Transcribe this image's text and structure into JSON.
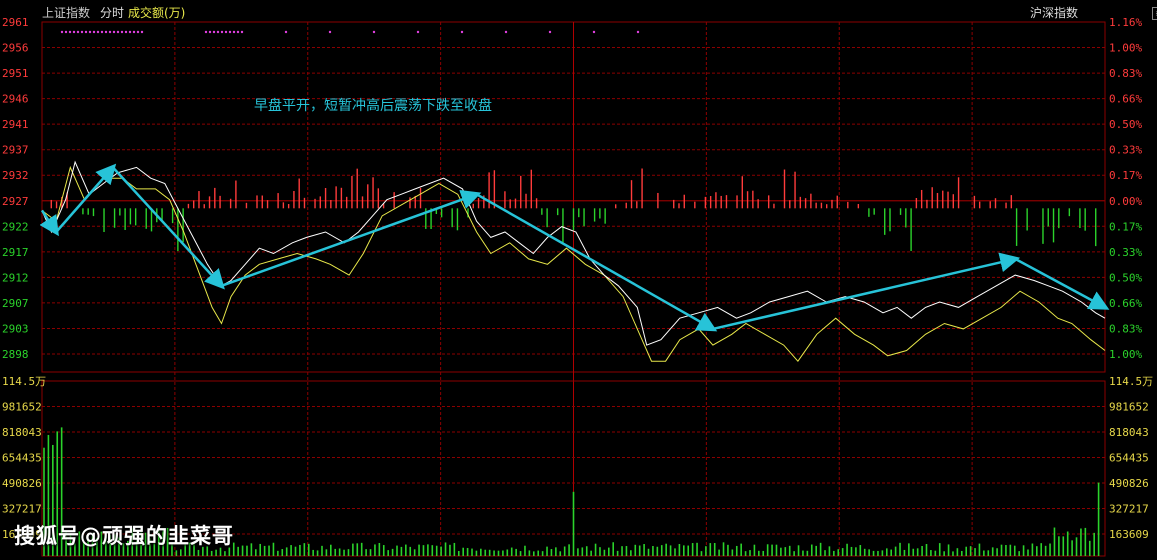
{
  "header": {
    "index_name": "上证指数",
    "period": "分时",
    "indicator": "成交额(万)",
    "right_label": "沪深指数"
  },
  "annotation": "早盘平开，短暂冲高后震荡下跌至收盘",
  "watermark": "搜狐号@顽强的韭菜哥",
  "colors": {
    "price_line": "#ffffff",
    "avg_line": "#e8e84a",
    "up": "#ff3b3b",
    "down": "#2bd32b",
    "grid": "#8b0000",
    "arrow": "#27c3d8",
    "volume": "#2bd32b"
  },
  "chart_data": [
    {
      "type": "line",
      "title": "上证指数 分时",
      "y_left_ticks": [
        "2961",
        "2956",
        "2951",
        "2946",
        "2941",
        "2937",
        "2932",
        "2927",
        "2922",
        "2917",
        "2912",
        "2907",
        "2903",
        "2898"
      ],
      "y_right_ticks": [
        "1.16%",
        "1.00%",
        "0.83%",
        "0.66%",
        "0.50%",
        "0.33%",
        "0.17%",
        "0.00%",
        "0.17%",
        "0.33%",
        "0.50%",
        "0.66%",
        "0.83%",
        "1.00%"
      ],
      "ylim": [
        2896,
        2961
      ],
      "x": "minute index 0-240",
      "series": [
        {
          "name": "price",
          "points": [
            [
              0,
              2926
            ],
            [
              4,
              2922
            ],
            [
              10,
              2928
            ],
            [
              14,
              2935
            ],
            [
              20,
              2929
            ],
            [
              26,
              2931
            ],
            [
              32,
              2933
            ],
            [
              40,
              2934
            ],
            [
              46,
              2932
            ],
            [
              52,
              2931
            ],
            [
              58,
              2926
            ],
            [
              64,
              2921
            ],
            [
              70,
              2916
            ],
            [
              76,
              2912
            ],
            [
              80,
              2913
            ],
            [
              86,
              2916
            ],
            [
              92,
              2919
            ],
            [
              98,
              2918
            ],
            [
              106,
              2920
            ],
            [
              112,
              2921
            ],
            [
              120,
              2922
            ],
            [
              128,
              2920
            ],
            [
              134,
              2922
            ],
            [
              140,
              2925
            ],
            [
              146,
              2928
            ],
            [
              152,
              2929
            ],
            [
              158,
              2930
            ],
            [
              164,
              2931
            ],
            [
              170,
              2932
            ],
            [
              178,
              2930
            ],
            [
              184,
              2924
            ],
            [
              190,
              2921
            ],
            [
              196,
              2922
            ],
            [
              202,
              2920
            ],
            [
              208,
              2918
            ],
            [
              214,
              2921
            ],
            [
              220,
              2923
            ],
            [
              226,
              2922
            ],
            [
              232,
              2917
            ],
            [
              238,
              2914
            ],
            [
              244,
              2912
            ],
            [
              252,
              2908
            ],
            [
              256,
              2901
            ],
            [
              262,
              2902
            ],
            [
              270,
              2906
            ],
            [
              278,
              2907
            ],
            [
              286,
              2908
            ],
            [
              294,
              2906
            ],
            [
              300,
              2907
            ],
            [
              308,
              2909
            ],
            [
              316,
              2910
            ],
            [
              324,
              2911
            ],
            [
              332,
              2909
            ],
            [
              340,
              2910
            ],
            [
              348,
              2909
            ],
            [
              356,
              2907
            ],
            [
              362,
              2908
            ],
            [
              368,
              2906
            ],
            [
              374,
              2908
            ],
            [
              380,
              2909
            ],
            [
              388,
              2908
            ],
            [
              396,
              2910
            ],
            [
              404,
              2912
            ],
            [
              412,
              2914
            ],
            [
              420,
              2913
            ],
            [
              426,
              2912
            ],
            [
              432,
              2911
            ],
            [
              440,
              2909
            ],
            [
              446,
              2907
            ],
            [
              450,
              2906
            ]
          ]
        },
        {
          "name": "average",
          "points": [
            [
              0,
              2926
            ],
            [
              6,
              2924
            ],
            [
              12,
              2934
            ],
            [
              18,
              2928
            ],
            [
              26,
              2932
            ],
            [
              34,
              2932
            ],
            [
              40,
              2930
            ],
            [
              48,
              2930
            ],
            [
              54,
              2928
            ],
            [
              60,
              2922
            ],
            [
              66,
              2915
            ],
            [
              72,
              2908
            ],
            [
              76,
              2905
            ],
            [
              80,
              2910
            ],
            [
              86,
              2914
            ],
            [
              92,
              2916
            ],
            [
              100,
              2917
            ],
            [
              108,
              2918
            ],
            [
              116,
              2917
            ],
            [
              122,
              2916
            ],
            [
              130,
              2914
            ],
            [
              136,
              2918
            ],
            [
              144,
              2925
            ],
            [
              152,
              2927
            ],
            [
              160,
              2929
            ],
            [
              168,
              2931
            ],
            [
              176,
              2929
            ],
            [
              184,
              2922
            ],
            [
              190,
              2918
            ],
            [
              198,
              2920
            ],
            [
              206,
              2917
            ],
            [
              214,
              2916
            ],
            [
              222,
              2919
            ],
            [
              230,
              2916
            ],
            [
              238,
              2914
            ],
            [
              246,
              2910
            ],
            [
              252,
              2904
            ],
            [
              258,
              2898
            ],
            [
              264,
              2898
            ],
            [
              270,
              2902
            ],
            [
              278,
              2904
            ],
            [
              284,
              2901
            ],
            [
              292,
              2903
            ],
            [
              298,
              2905
            ],
            [
              306,
              2903
            ],
            [
              314,
              2901
            ],
            [
              320,
              2898
            ],
            [
              328,
              2903
            ],
            [
              336,
              2906
            ],
            [
              344,
              2903
            ],
            [
              352,
              2901
            ],
            [
              358,
              2899
            ],
            [
              366,
              2900
            ],
            [
              374,
              2903
            ],
            [
              382,
              2905
            ],
            [
              390,
              2904
            ],
            [
              398,
              2906
            ],
            [
              406,
              2908
            ],
            [
              414,
              2911
            ],
            [
              422,
              2909
            ],
            [
              430,
              2906
            ],
            [
              436,
              2905
            ],
            [
              444,
              2902
            ],
            [
              450,
              2900
            ]
          ]
        }
      ],
      "trend_arrows": [
        {
          "from": [
            0,
            2926
          ],
          "to": [
            6,
            2922
          ]
        },
        {
          "from": [
            6,
            2922
          ],
          "to": [
            30,
            2934
          ]
        },
        {
          "from": [
            30,
            2934
          ],
          "to": [
            76,
            2912
          ]
        },
        {
          "from": [
            76,
            2912
          ],
          "to": [
            184,
            2929
          ]
        },
        {
          "from": [
            184,
            2929
          ],
          "to": [
            284,
            2904
          ]
        },
        {
          "from": [
            284,
            2904
          ],
          "to": [
            412,
            2917
          ]
        },
        {
          "from": [
            412,
            2917
          ],
          "to": [
            450,
            2908
          ]
        }
      ]
    },
    {
      "type": "bar",
      "title": "成交额(万)",
      "y_ticks": [
        "114.5万",
        "981652",
        "818043",
        "654435",
        "490826",
        "327217",
        "163609"
      ],
      "ylim": [
        0,
        1145000
      ],
      "note": "per-minute turnover bars"
    }
  ]
}
